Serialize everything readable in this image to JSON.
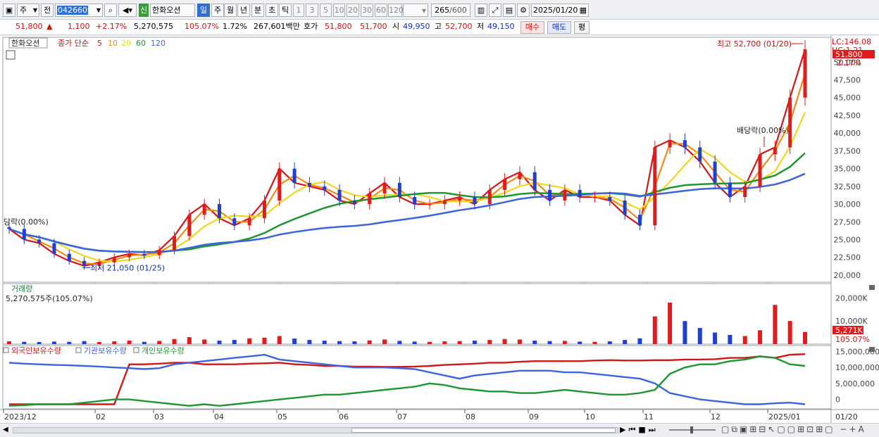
{
  "toolbar": {
    "period_type": "주",
    "prev_label": "전",
    "stock_code": "042660",
    "credit_badge": "신",
    "stock_name": "한화오션",
    "timeframes": [
      "일",
      "주",
      "월",
      "년",
      "분",
      "초",
      "틱"
    ],
    "active_timeframe": "일",
    "intervals": [
      "1",
      "3",
      "5",
      "10",
      "20",
      "30",
      "60",
      "120"
    ],
    "count_display": "265",
    "count_max": "/600",
    "date": "2025/01/20"
  },
  "quote": {
    "price": "51,800",
    "change_arrow": "▲",
    "change": "1,100",
    "change_pct": "+2.17%",
    "volume": "5,270,575",
    "volume_ratio": "105.07%",
    "turnover": "1.72%",
    "amount": "267,601백만",
    "ask_label": "호가",
    "ask": "51,800",
    "bid": "51,700",
    "open_label": "시",
    "open": "49,950",
    "high_label": "고",
    "high": "52,700",
    "low_label": "저",
    "low": "49,150",
    "buy_label": "매수",
    "sell_label": "매도",
    "avg_label": "평"
  },
  "price_panel": {
    "stock_label": "한화오션",
    "ma_title": "종가 단순",
    "ma_periods": [
      {
        "label": "5",
        "color": "#d01818"
      },
      {
        "label": "10",
        "color": "#f08c14"
      },
      {
        "label": "20",
        "color": "#f0d81e"
      },
      {
        "label": "60",
        "color": "#1e9632"
      },
      {
        "label": "120",
        "color": "#3c64dc"
      }
    ],
    "lc_label": "LC:146.08",
    "hc_label": "HC:1.21",
    "current_price_tag": "51,800",
    "current_pct_tag": "2.17%",
    "high_annotation": "최고 52,700 (01/20)",
    "low_annotation": "최저 21,050 (01/25)",
    "dividend_annotation": "배당락(0.00%)",
    "left_annotation": "당락(0.00%)"
  },
  "volume_panel": {
    "title": "거래량",
    "value_label": "5,270,575주(105.07%)",
    "axis_ticks": [
      "20,000K",
      "10,000K"
    ],
    "current_tag": "5,271K",
    "pct_tag": "105.07%"
  },
  "holdings_panel": {
    "series_labels": [
      "외국인보유수량",
      "기관보유수량",
      "개인보유수량"
    ],
    "series_colors": [
      "#d01818",
      "#3c64dc",
      "#1e9632"
    ],
    "axis_ticks": [
      "15,000,000",
      "10,000,000",
      "5,000,000",
      "0"
    ]
  },
  "x_axis": {
    "labels": [
      "2023/12",
      "02",
      "03",
      "04",
      "05",
      "06",
      "07",
      "08",
      "09",
      "10",
      "11",
      "12",
      "2025/01"
    ],
    "right_label": "01/20"
  },
  "chart_data": {
    "type": "candlestick",
    "title": "",
    "x_labels": [
      "2023/12",
      "02",
      "03",
      "04",
      "05",
      "06",
      "07",
      "08",
      "09",
      "10",
      "11",
      "12",
      "2025/01"
    ],
    "y_ticks": [
      20000,
      22500,
      25000,
      27500,
      30000,
      32500,
      35000,
      37500,
      40000,
      42500,
      45000,
      47500,
      50000
    ],
    "ylim": [
      19000,
      53500
    ],
    "close_series": [
      [
        "2023/12",
        26500
      ],
      [
        "2023/12",
        25000
      ],
      [
        "2023/12",
        24500
      ],
      [
        "2024/01",
        23000
      ],
      [
        "2024/01",
        22000
      ],
      [
        "2024/01",
        21300
      ],
      [
        "2024/02",
        21800
      ],
      [
        "2024/02",
        22500
      ],
      [
        "2024/02",
        23000
      ],
      [
        "2024/02",
        22800
      ],
      [
        "2024/03",
        23500
      ],
      [
        "2024/03",
        25500
      ],
      [
        "2024/03",
        28500
      ],
      [
        "2024/03",
        30000
      ],
      [
        "2024/04",
        28000
      ],
      [
        "2024/04",
        27000
      ],
      [
        "2024/04",
        28000
      ],
      [
        "2024/04",
        30500
      ],
      [
        "2024/05",
        35000
      ],
      [
        "2024/05",
        33000
      ],
      [
        "2024/05",
        32500
      ],
      [
        "2024/05",
        32000
      ],
      [
        "2024/06",
        30500
      ],
      [
        "2024/06",
        30000
      ],
      [
        "2024/06",
        31500
      ],
      [
        "2024/06",
        33000
      ],
      [
        "2024/07",
        31000
      ],
      [
        "2024/07",
        30000
      ],
      [
        "2024/07",
        30000
      ],
      [
        "2024/07",
        30500
      ],
      [
        "2024/08",
        31000
      ],
      [
        "2024/08",
        30000
      ],
      [
        "2024/08",
        32000
      ],
      [
        "2024/08",
        33500
      ],
      [
        "2024/09",
        34500
      ],
      [
        "2024/09",
        32000
      ],
      [
        "2024/09",
        30500
      ],
      [
        "2024/09",
        32000
      ],
      [
        "2024/10",
        31000
      ],
      [
        "2024/10",
        31000
      ],
      [
        "2024/10",
        30500
      ],
      [
        "2024/10",
        28500
      ],
      [
        "2024/11",
        27000
      ],
      [
        "2024/11",
        38000
      ],
      [
        "2024/11",
        39000
      ],
      [
        "2024/11",
        38000
      ],
      [
        "2024/12",
        36000
      ],
      [
        "2024/12",
        33000
      ],
      [
        "2024/12",
        31000
      ],
      [
        "2024/12",
        32500
      ],
      [
        "2025/01",
        37000
      ],
      [
        "2025/01",
        38000
      ],
      [
        "2025/01",
        45000
      ],
      [
        "2025/01",
        51800
      ]
    ],
    "ma_series": [
      {
        "name": "5",
        "color": "#d01818"
      },
      {
        "name": "10",
        "color": "#f08c14"
      },
      {
        "name": "20",
        "color": "#f0d81e"
      },
      {
        "name": "60",
        "color": "#1e9632"
      },
      {
        "name": "120",
        "color": "#3c64dc"
      }
    ],
    "annotations": {
      "high": {
        "label": "최고 52,700 (01/20)",
        "value": 52700
      },
      "low": {
        "label": "최저 21,050 (01/25)",
        "value": 21050
      }
    },
    "volume": {
      "ylim": [
        0,
        25000000
      ],
      "y_ticks": [
        20000000,
        10000000
      ],
      "values": [
        1200000,
        1000000,
        900000,
        1100000,
        1000000,
        1300000,
        900000,
        1200000,
        1500000,
        1000000,
        1400000,
        2200000,
        3000000,
        2000000,
        1500000,
        1800000,
        2500000,
        2800000,
        3500000,
        2400000,
        1800000,
        1500000,
        1300000,
        1200000,
        1600000,
        2000000,
        1400000,
        1100000,
        1000000,
        1200000,
        1300000,
        1500000,
        1800000,
        2200000,
        2000000,
        1500000,
        1300000,
        1400000,
        1100000,
        1000000,
        1200000,
        1800000,
        2500000,
        12000000,
        18000000,
        10000000,
        7000000,
        5000000,
        4000000,
        3500000,
        6000000,
        17000000,
        10000000,
        5270575
      ]
    },
    "holdings": {
      "ylim": [
        -2500000,
        16000000
      ],
      "y_ticks": [
        15000000,
        10000000,
        5000000,
        0
      ],
      "foreign": [
        -1500000,
        -1500000,
        -1500000,
        -1500000,
        -1500000,
        -1500000,
        -1500000,
        -1500000,
        11000000,
        11000000,
        11200000,
        11500000,
        11500000,
        11000000,
        11000000,
        11000000,
        11200000,
        11300000,
        11500000,
        11000000,
        10800000,
        10500000,
        10500000,
        10300000,
        10300000,
        10200000,
        10200000,
        10300000,
        10500000,
        10800000,
        11000000,
        11200000,
        11500000,
        11500000,
        11800000,
        12000000,
        12000000,
        12000000,
        12000000,
        12200000,
        12300000,
        12200000,
        12200000,
        12300000,
        12300000,
        12500000,
        12500000,
        12600000,
        13000000,
        13000000,
        13500000,
        13000000,
        14000000,
        14200000
      ],
      "institution": [
        11500000,
        11200000,
        11000000,
        10800000,
        10700000,
        10500000,
        10300000,
        10000000,
        9800000,
        9500000,
        9800000,
        11000000,
        11500000,
        12000000,
        12500000,
        13000000,
        13500000,
        14000000,
        12500000,
        12000000,
        11500000,
        11000000,
        10500000,
        10000000,
        10000000,
        10000000,
        9800000,
        9500000,
        8500000,
        7500000,
        6500000,
        7500000,
        8000000,
        8500000,
        9000000,
        9000000,
        9000000,
        8500000,
        8500000,
        8000000,
        7500000,
        7000000,
        6500000,
        5000000,
        2000000,
        1000000,
        0,
        -500000,
        -1000000,
        -1500000,
        -1500000,
        -1200000,
        -1000000,
        -1500000
      ],
      "individual": [
        -2000000,
        -1800000,
        -1500000,
        -1500000,
        -1500000,
        -1000000,
        -500000,
        0,
        0,
        -500000,
        -1000000,
        -1500000,
        -2000000,
        -1500000,
        -2000000,
        -1500000,
        -1000000,
        -500000,
        0,
        500000,
        1000000,
        1500000,
        1500000,
        2000000,
        2500000,
        3000000,
        3500000,
        4000000,
        5000000,
        4500000,
        3500000,
        3000000,
        2500000,
        2500000,
        2000000,
        2000000,
        2500000,
        3000000,
        2500000,
        2000000,
        1500000,
        1500000,
        2000000,
        3000000,
        8000000,
        10000000,
        11000000,
        11000000,
        12000000,
        12500000,
        13500000,
        13000000,
        11000000,
        10500000
      ]
    }
  }
}
